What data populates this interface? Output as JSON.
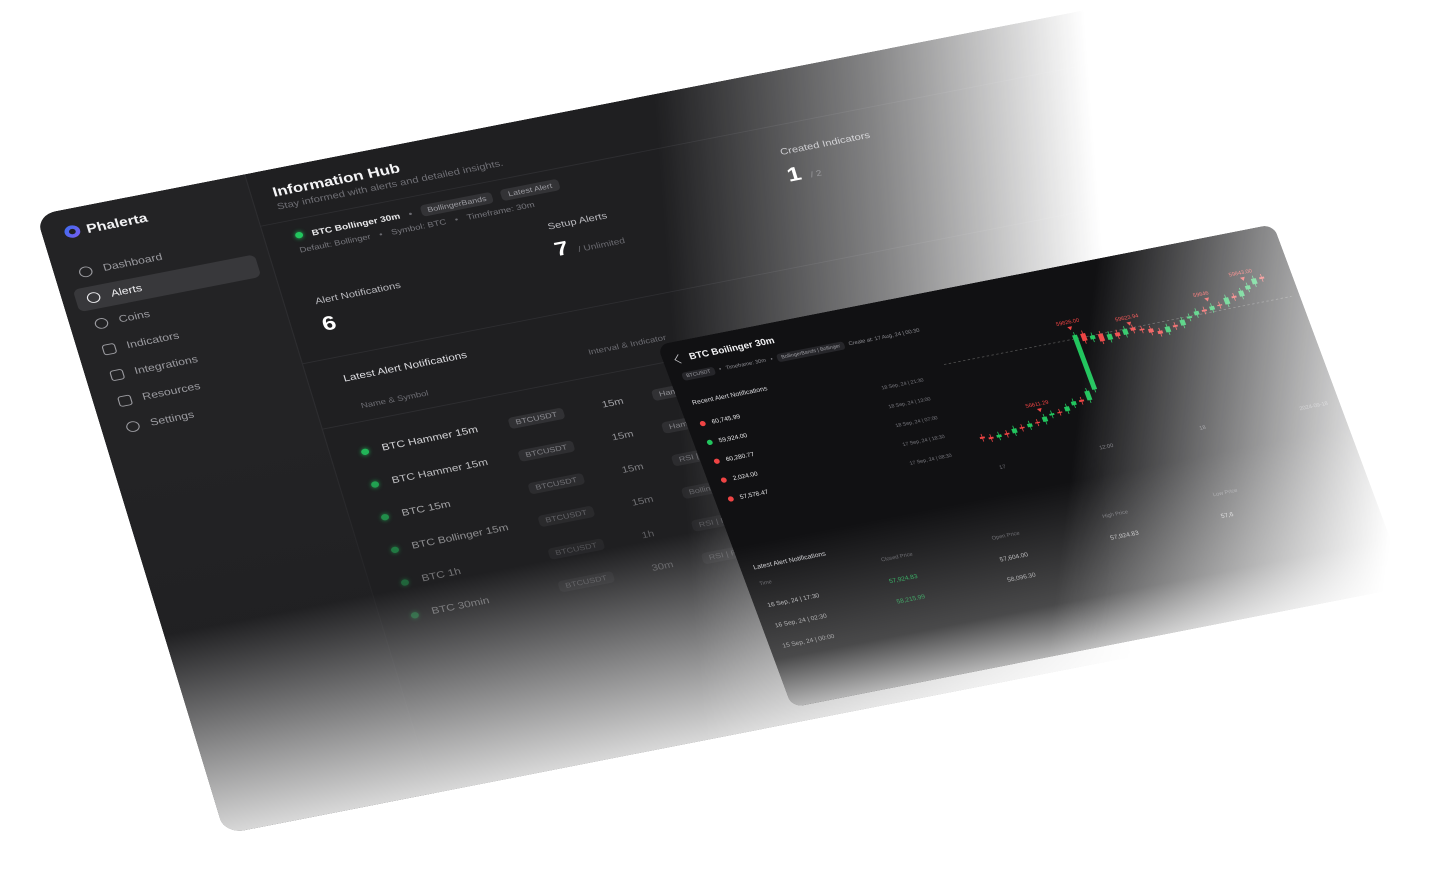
{
  "sidebar": {
    "brand": "Phalerta",
    "items": [
      {
        "label": "Dashboard",
        "icon": "dashboard-icon"
      },
      {
        "label": "Alerts",
        "icon": "alarm-clock-icon",
        "active": true
      },
      {
        "label": "Coins",
        "icon": "coins-icon"
      },
      {
        "label": "Indicators",
        "icon": "indicators-icon"
      },
      {
        "label": "Integrations",
        "icon": "integrations-icon"
      },
      {
        "label": "Resources",
        "icon": "resources-icon"
      },
      {
        "label": "Settings",
        "icon": "settings-icon"
      }
    ]
  },
  "hub": {
    "title": "Information Hub",
    "subtitle": "Stay informed with alerts and detailed insights."
  },
  "current_alert": {
    "name": "BTC Bollinger 30m",
    "chips": [
      "BollingerBands",
      "Latest Alert"
    ],
    "default": "Default: Bollinger",
    "symbol": "Symbol: BTC",
    "timeframe": "Timeframe: 30m"
  },
  "stats": {
    "alert_notifications": {
      "label": "Alert Notifications",
      "value": "6"
    },
    "setup_alerts": {
      "label": "Setup Alerts",
      "value": "7",
      "sub": "/ Unlimited"
    },
    "created_indicators": {
      "label": "Created Indicators",
      "value": "1",
      "sub": "/ 2"
    }
  },
  "latest": {
    "title": "Latest Alert Notifications",
    "columns": {
      "name": "Name & Symbol",
      "interval": "Interval & Indicator"
    },
    "rows": [
      {
        "name": "BTC Hammer 15m",
        "symbol": "BTCUSDT",
        "interval": "15m",
        "indicator": "HammerPattern |"
      },
      {
        "name": "BTC Hammer 15m",
        "symbol": "BTCUSDT",
        "interval": "15m",
        "indicator": "HammerPattern |"
      },
      {
        "name": "BTC 15m",
        "symbol": "BTCUSDT",
        "interval": "15m",
        "indicator": "RSI | RSI"
      },
      {
        "name": "BTC Bollinger 15m",
        "symbol": "BTCUSDT",
        "interval": "15m",
        "indicator": "BollingerBands |"
      },
      {
        "name": "BTC 1h",
        "symbol": "BTCUSDT",
        "interval": "1h",
        "indicator": "RSI | RSI"
      },
      {
        "name": "BTC 30min",
        "symbol": "BTCUSDT",
        "interval": "30m",
        "indicator": "RSI | RSI"
      }
    ]
  },
  "detail": {
    "title": "BTC Boilinger 30m",
    "symbol_chip": "BTCUSDT",
    "timeframe": "Timeframe: 30m",
    "indicator_chip": "BollingerBands | Bollinger",
    "created": "Create at: 17 Aug, 24 | 00:30",
    "recent_title": "Recent Alert Notifications",
    "recent": [
      {
        "price": "60,745.99",
        "status": "red",
        "time": "18 Sep, 24 | 21:30"
      },
      {
        "price": "59,924.00",
        "status": "green",
        "time": "18 Sep, 24 | 13:00"
      },
      {
        "price": "60,280.77",
        "status": "red",
        "time": "18 Sep, 24 | 07:00"
      },
      {
        "price": "2,024.00",
        "status": "red",
        "time": "17 Sep, 24 | 18:30"
      },
      {
        "price": "57,578.47",
        "status": "red",
        "time": "17 Sep, 24 | 08:30"
      }
    ],
    "latest_title": "Latest Alert Notifications",
    "table_columns": [
      "Time",
      "Closed Price",
      "Open Price",
      "High Price",
      "Low Price"
    ],
    "table_rows": [
      {
        "time": "16 Sep, 24 | 17:30",
        "closed": "57,924.83",
        "open": "57,604.00",
        "high": "57,924.83",
        "low": "57,6"
      },
      {
        "time": "16 Sep, 24 | 02:30",
        "closed": "58,215.99",
        "open": "58,096.30",
        "high": "",
        "low": ""
      },
      {
        "time": "15 Sep, 24 | 00:00",
        "closed": "",
        "open": "",
        "high": "",
        "low": ""
      }
    ]
  },
  "chart_data": {
    "type": "candlestick",
    "title": "",
    "xlabel": "",
    "ylabel": "",
    "x_ticks": [
      "17",
      "12:00",
      "18",
      "2024-09-18"
    ],
    "markers": [
      {
        "index": 8,
        "label": "56611.29"
      },
      {
        "index": 15,
        "label": "59826.00"
      },
      {
        "index": 22,
        "label": "59623.94"
      },
      {
        "index": 32,
        "label": "59846"
      },
      {
        "index": 37,
        "label": "59843.00"
      }
    ],
    "closes": [
      57600,
      57550,
      57620,
      57580,
      57700,
      57660,
      57750,
      57720,
      57850,
      57900,
      57880,
      58000,
      58100,
      58050,
      58300,
      59800,
      59600,
      59700,
      59500,
      59650,
      59550,
      59700,
      59620,
      59580,
      59480,
      59400,
      59550,
      59500,
      59650,
      59700,
      59800,
      59750,
      59850,
      59820,
      60000,
      59950,
      60100,
      60200,
      60350,
      60300
    ],
    "opens": [
      57650,
      57600,
      57550,
      57620,
      57580,
      57700,
      57660,
      57750,
      57720,
      57850,
      57900,
      57880,
      58000,
      58100,
      58050,
      58300,
      59800,
      59600,
      59700,
      59500,
      59650,
      59550,
      59700,
      59620,
      59580,
      59480,
      59400,
      59550,
      59500,
      59650,
      59700,
      59800,
      59750,
      59850,
      59820,
      60000,
      59950,
      60100,
      60200,
      60350
    ],
    "up_color": "#22c55e",
    "down_color": "#ef4444"
  },
  "colors": {
    "accent": "#22c55e",
    "alert": "#ef4444",
    "bg": "#1f1f21"
  }
}
